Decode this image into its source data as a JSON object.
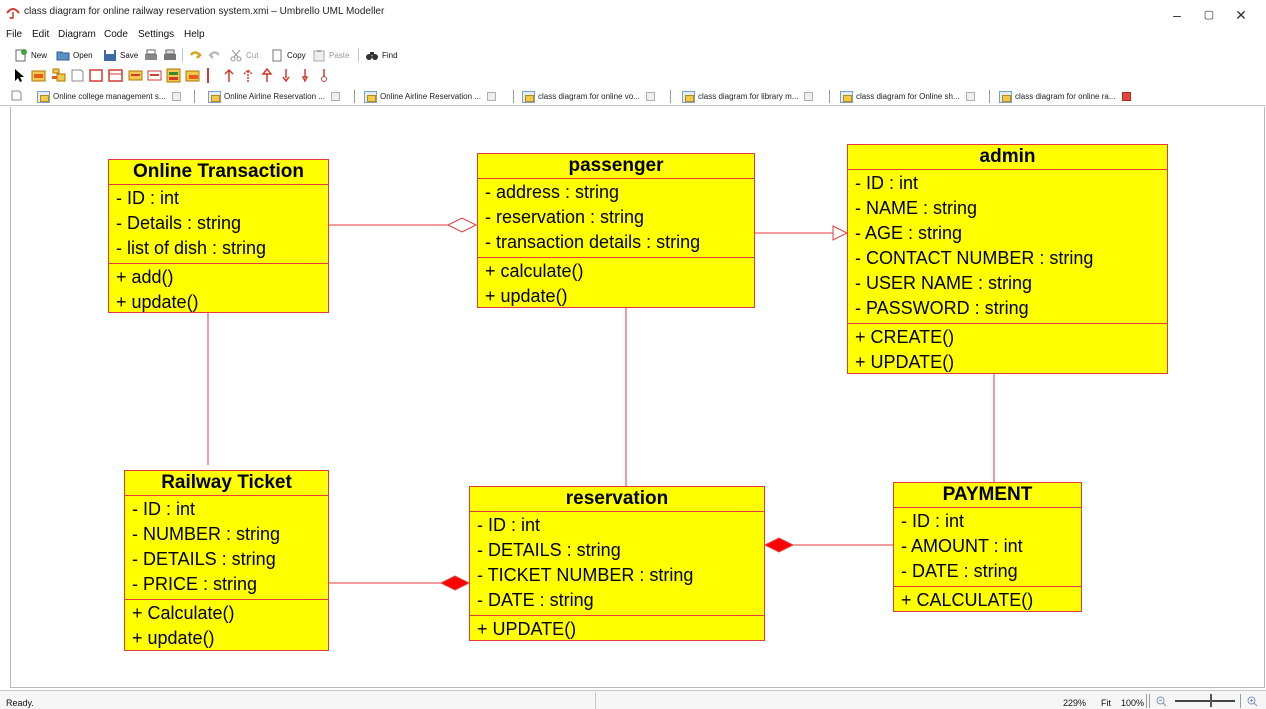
{
  "window": {
    "title": "class diagram for online railway reservation system.xmi – Umbrello UML Modeller",
    "minimize": "–",
    "maximize": "▢",
    "close": "✕"
  },
  "menu": {
    "items": [
      "File",
      "Edit",
      "Diagram",
      "Code",
      "Settings",
      "Help"
    ]
  },
  "toolbar": {
    "new_label": "New",
    "open_label": "Open",
    "save_label": "Save",
    "cut_label": "Cut",
    "copy_label": "Copy",
    "paste_label": "Paste",
    "find_label": "Find"
  },
  "tabs": [
    {
      "label": "Online college management s...",
      "active": false
    },
    {
      "label": "Online Airline Reservation ...",
      "active": false
    },
    {
      "label": "Online Airline Reservation ...",
      "active": false
    },
    {
      "label": "class diagram for online vo...",
      "active": false
    },
    {
      "label": "class diagram for library m...",
      "active": false
    },
    {
      "label": "class diagram for Online sh...",
      "active": false
    },
    {
      "label": "class diagram for online ra...",
      "active": true
    }
  ],
  "diagram": {
    "classes": {
      "online_transaction": {
        "name": "Online Transaction",
        "attributes": [
          "- ID : int",
          "- Details : string",
          "- list of dish : string"
        ],
        "operations": [
          "+ add()",
          "+ update()"
        ]
      },
      "passenger": {
        "name": "passenger",
        "attributes": [
          "- address : string",
          "- reservation : string",
          "- transaction details : string"
        ],
        "operations": [
          "+ calculate()",
          "+ update()"
        ]
      },
      "admin": {
        "name": "admin",
        "attributes": [
          "- ID : int",
          "- NAME : string",
          "- AGE : string",
          "- CONTACT NUMBER : string",
          "- USER NAME : string",
          "- PASSWORD : string"
        ],
        "operations": [
          "+ CREATE()",
          "+ UPDATE()"
        ]
      },
      "railway_ticket": {
        "name": "Railway Ticket",
        "attributes": [
          "- ID : int",
          "- NUMBER : string",
          "- DETAILS : string",
          "- PRICE : string"
        ],
        "operations": [
          "+ Calculate()",
          "+ update()"
        ]
      },
      "reservation": {
        "name": "reservation",
        "attributes": [
          "- ID : int",
          "- DETAILS : string",
          "- TICKET NUMBER : string",
          "- DATE : string"
        ],
        "operations": [
          "+ UPDATE()"
        ]
      },
      "payment": {
        "name": "PAYMENT",
        "attributes": [
          "- ID : int",
          "- AMOUNT : int",
          "- DATE : string"
        ],
        "operations": [
          "+ CALCULATE()"
        ]
      }
    },
    "colors": {
      "class_fill": "#ffff00",
      "class_border": "#e33b3b",
      "link": "#e33b3b"
    }
  },
  "status": {
    "text": "Ready.",
    "zoom_level": "229%",
    "fit_label": "Fit",
    "hundred_label": "100%"
  }
}
